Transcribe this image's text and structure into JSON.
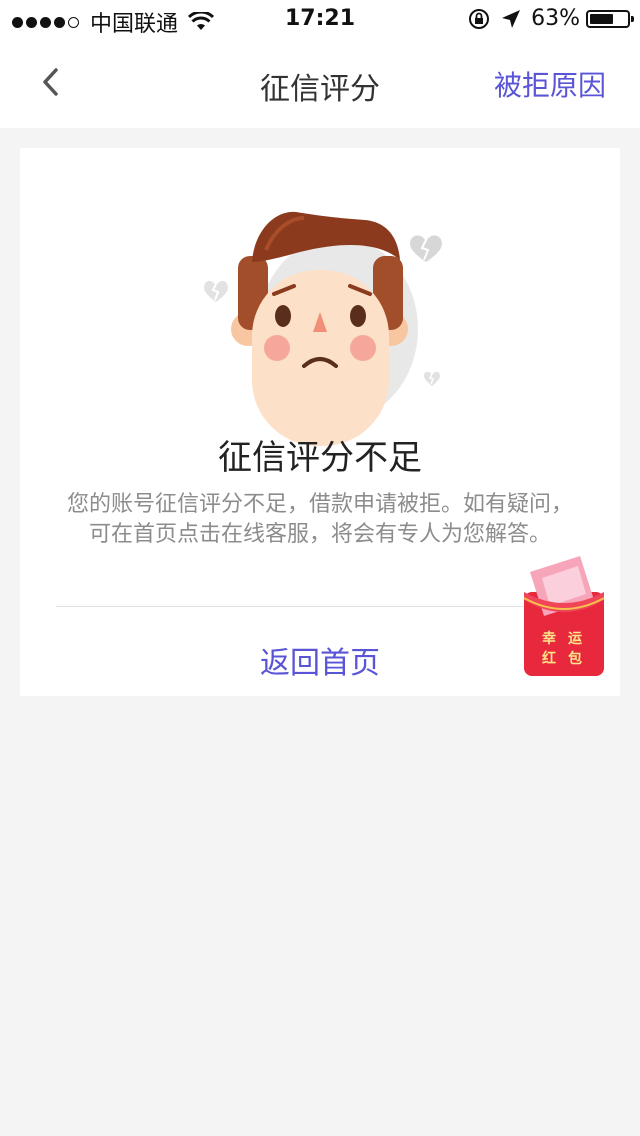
{
  "status_bar": {
    "carrier": "中国联通",
    "time": "17:21",
    "battery": "63%",
    "battery_level": 0.63,
    "signal_filled": 4,
    "signal_total": 5
  },
  "nav": {
    "title": "征信评分",
    "right_action": "被拒原因",
    "back_icon": "chevron-left-icon"
  },
  "result": {
    "title": "征信评分不足",
    "description": "您的账号征信评分不足，借款申请被拒。如有疑问，可在首页点击在线客服，将会有专人为您解答。",
    "home_link": "返回首页"
  },
  "red_packet": {
    "chars": [
      "幸",
      "运",
      "红",
      "包"
    ]
  },
  "colors": {
    "accent": "#5a54d6",
    "background": "#f4f4f4",
    "red_packet": "#e8283c"
  }
}
